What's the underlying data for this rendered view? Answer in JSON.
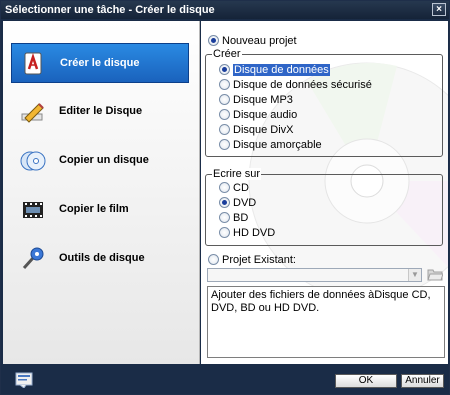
{
  "window": {
    "title": "Sélectionner une tâche - Créer le disque",
    "close_symbol": "×"
  },
  "sidebar": {
    "items": [
      {
        "label": "Créer le disque",
        "icon": "create-disc-icon",
        "active": true
      },
      {
        "label": "Editer le Disque",
        "icon": "edit-pen-icon",
        "active": false
      },
      {
        "label": "Copier un disque",
        "icon": "copy-disc-icon",
        "active": false
      },
      {
        "label": "Copier le film",
        "icon": "film-strip-icon",
        "active": false
      },
      {
        "label": "Outils de disque",
        "icon": "disc-tools-icon",
        "active": false
      }
    ]
  },
  "main": {
    "new_project_label": "Nouveau projet",
    "create_group": {
      "legend": "Créer",
      "options": [
        {
          "label": "Disque de données",
          "checked": true
        },
        {
          "label": "Disque de données sécurisé",
          "checked": false
        },
        {
          "label": "Disque MP3",
          "checked": false
        },
        {
          "label": "Disque audio",
          "checked": false
        },
        {
          "label": "Disque DivX",
          "checked": false
        },
        {
          "label": "Disque amorçable",
          "checked": false
        }
      ]
    },
    "write_group": {
      "legend": "Ecrire sur",
      "options": [
        {
          "label": "CD",
          "checked": false
        },
        {
          "label": "DVD",
          "checked": true
        },
        {
          "label": "BD",
          "checked": false
        },
        {
          "label": "HD DVD",
          "checked": false
        }
      ]
    },
    "existing_project_label": "Projet Existant:",
    "project_path_value": "",
    "description": "Ajouter des fichiers de données àDisque CD, DVD, BD ou HD DVD."
  },
  "footer": {
    "ok_label": "OK",
    "cancel_label": "Annuler"
  },
  "colors": {
    "accent": "#1a62bd",
    "frame": "#1a2c47",
    "selection": "#2f65c7"
  }
}
